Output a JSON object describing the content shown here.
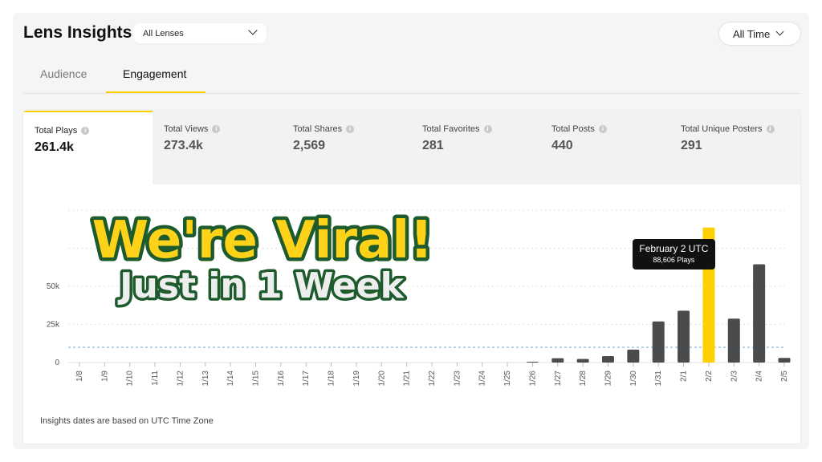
{
  "header": {
    "title": "Lens Insights",
    "lens_select": "All Lenses",
    "time_select": "All Time"
  },
  "tabs": [
    {
      "label": "Audience",
      "active": false
    },
    {
      "label": "Engagement",
      "active": true
    }
  ],
  "metrics": [
    {
      "label": "Total Plays",
      "value": "261.4k",
      "active": true
    },
    {
      "label": "Total Views",
      "value": "273.4k",
      "active": false
    },
    {
      "label": "Total Shares",
      "value": "2,569",
      "active": false
    },
    {
      "label": "Total Favorites",
      "value": "281",
      "active": false
    },
    {
      "label": "Total Posts",
      "value": "440",
      "active": false
    },
    {
      "label": "Total Unique Posters",
      "value": "291",
      "active": false
    }
  ],
  "tooltip": {
    "date": "February 2 UTC",
    "value": "88,606 Plays"
  },
  "footnote": "Insights dates are based on UTC Time Zone",
  "overlay": {
    "headline": "We're Viral!",
    "subline": "Just in 1 Week"
  },
  "colors": {
    "accent": "#ffd000",
    "bar": "#4a4b4d",
    "highlight_bar": "#ffd000",
    "reference_line": "#6aa6c8",
    "headline_fill": "#ffd21a",
    "headline_outline": "#1d5a2c"
  },
  "chart_data": {
    "type": "bar",
    "categories": [
      "1/8",
      "1/9",
      "1/10",
      "1/11",
      "1/12",
      "1/13",
      "1/14",
      "1/15",
      "1/16",
      "1/17",
      "1/18",
      "1/19",
      "1/20",
      "1/21",
      "1/22",
      "1/23",
      "1/24",
      "1/25",
      "1/26",
      "1/27",
      "1/28",
      "1/29",
      "1/30",
      "1/31",
      "2/1",
      "2/2",
      "2/3",
      "2/4",
      "2/5"
    ],
    "values": [
      0,
      0,
      0,
      0,
      0,
      0,
      0,
      0,
      0,
      0,
      0,
      0,
      0,
      0,
      0,
      0,
      0,
      0,
      300,
      2800,
      2400,
      4200,
      8500,
      27000,
      34000,
      88606,
      28800,
      64500,
      3000
    ],
    "highlight": "2/2",
    "y_ticks": [
      "0",
      "25k",
      "50k"
    ],
    "y_tick_values": [
      0,
      25000,
      50000
    ],
    "ylim": [
      0,
      100000
    ],
    "reference_line": 10000,
    "grid": true
  }
}
